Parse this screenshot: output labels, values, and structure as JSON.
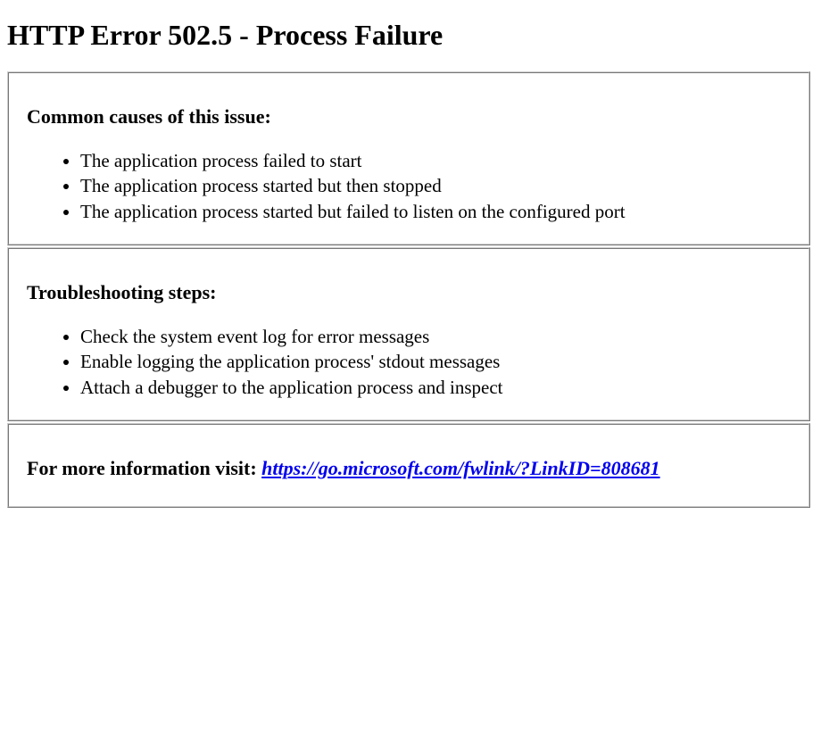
{
  "title": "HTTP Error 502.5 - Process Failure",
  "sections": {
    "causes": {
      "heading": "Common causes of this issue:",
      "items": [
        "The application process failed to start",
        "The application process started but then stopped",
        "The application process started but failed to listen on the configured port"
      ]
    },
    "troubleshooting": {
      "heading": "Troubleshooting steps:",
      "items": [
        "Check the system event log for error messages",
        "Enable logging the application process' stdout messages",
        "Attach a debugger to the application process and inspect"
      ]
    },
    "info": {
      "prefix": "For more information visit: ",
      "link_text": "https://go.microsoft.com/fwlink/?LinkID=808681",
      "link_href": "https://go.microsoft.com/fwlink/?LinkID=808681"
    }
  }
}
